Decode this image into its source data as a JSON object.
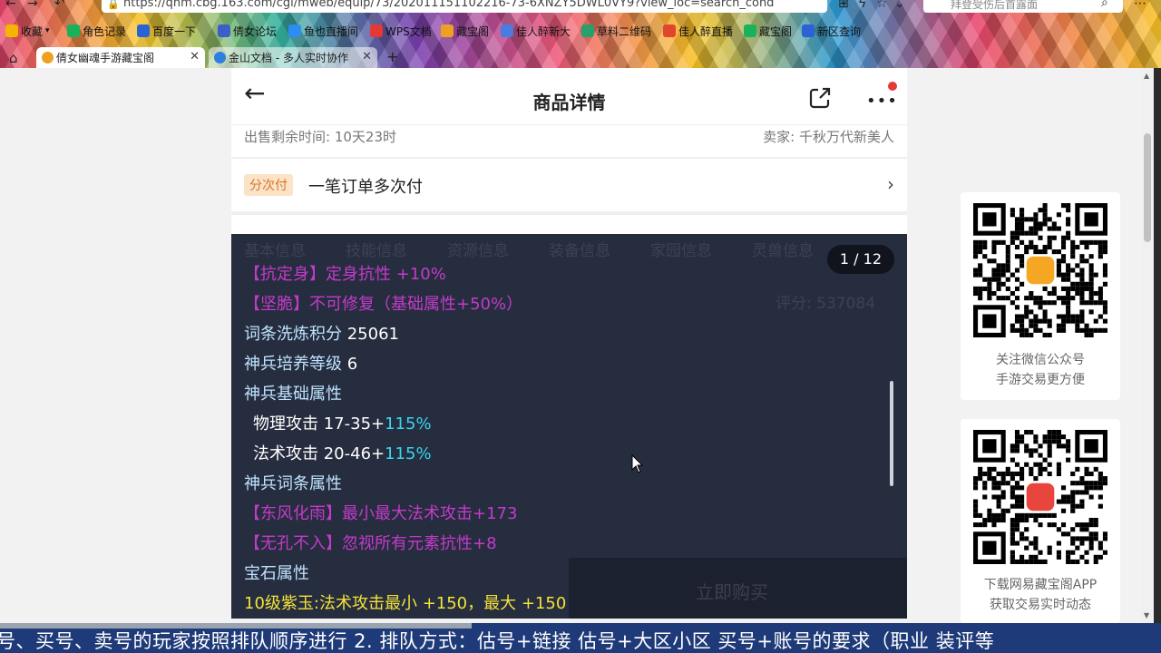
{
  "browser": {
    "url": "https://qnm.cbg.163.com/cgi/mweb/equip/73/202011151102216-73-6XNZY5DWL0VY9?view_loc=search_cond",
    "search_placeholder": "拜登受伤后首露面",
    "bookmarks": [
      "收藏",
      "角色记录",
      "百度一下",
      "倩女论坛",
      "鱼也直播间",
      "WPS文档",
      "藏宝阁",
      "佳人醉新大",
      "草料二维码",
      "佳人醉直播",
      "藏宝阁",
      "新区查询"
    ],
    "tabs": [
      {
        "label": "倩女幽魂手游藏宝阁",
        "active": true
      },
      {
        "label": "金山文档 - 多人实时协作",
        "active": false
      }
    ]
  },
  "header": {
    "title": "商品详情"
  },
  "listing": {
    "remaining": "出售剩余时间: 10天23时",
    "seller": "卖家: 千秋万代新美人",
    "split_badge": "分次付",
    "split_text": "一笔订单多次付"
  },
  "viewer": {
    "counter": "1 / 12",
    "ghost_tabs": [
      "基本信息",
      "技能信息",
      "资源信息",
      "装备信息",
      "家园信息",
      "灵兽信息"
    ],
    "ghost_score": "评分: 537084",
    "ghost_buy": "立即购买",
    "lines": [
      {
        "segs": [
          {
            "text": "【抗定身】定身抗性 +10%",
            "color": "pink"
          }
        ]
      },
      {
        "segs": [
          {
            "text": "【坚脆】不可修复（基础属性+50%）",
            "color": "pink"
          }
        ]
      },
      {
        "segs": [
          {
            "text": "词条洗炼积分 ",
            "color": "blue"
          },
          {
            "text": "25061",
            "color": "white"
          }
        ]
      },
      {
        "segs": [
          {
            "text": "神兵培养等级 ",
            "color": "blue"
          },
          {
            "text": "6",
            "color": "white"
          }
        ]
      },
      {
        "segs": [
          {
            "text": "神兵基础属性",
            "color": "blue"
          }
        ]
      },
      {
        "indent": true,
        "segs": [
          {
            "text": "物理攻击 17-35+",
            "color": "white"
          },
          {
            "text": "115%",
            "color": "cyan"
          }
        ]
      },
      {
        "indent": true,
        "segs": [
          {
            "text": "法术攻击 20-46+",
            "color": "white"
          },
          {
            "text": "115%",
            "color": "cyan"
          }
        ]
      },
      {
        "segs": [
          {
            "text": "神兵词条属性",
            "color": "blue"
          }
        ]
      },
      {
        "segs": [
          {
            "text": "【东风化雨】最小最大法术攻击+173",
            "color": "pink"
          }
        ]
      },
      {
        "segs": [
          {
            "text": "【无孔不入】忽视所有元素抗性+8",
            "color": "pink"
          }
        ]
      },
      {
        "segs": [
          {
            "text": "宝石属性",
            "color": "blue"
          }
        ]
      },
      {
        "segs": [
          {
            "text": "10级紫玉:法术攻击最小 +150，最大 +150",
            "color": "yellow"
          }
        ]
      }
    ]
  },
  "side": {
    "qr1_caption": [
      "关注微信公众号",
      "手游交易更方便"
    ],
    "qr2_caption": [
      "下载网易藏宝阁APP",
      "获取交易实时动态"
    ]
  },
  "ticker": {
    "text": "号、买号、卖号的玩家按照排队顺序进行    2. 排队方式：估号+链接    估号+大区小区    买号+账号的要求（职业  装评等"
  },
  "colors": {
    "pink": "#c43bcb",
    "white": "#ffffff",
    "blue": "#bfe3ff",
    "cyan": "#39d4f0",
    "yellow": "#f4e23a"
  }
}
